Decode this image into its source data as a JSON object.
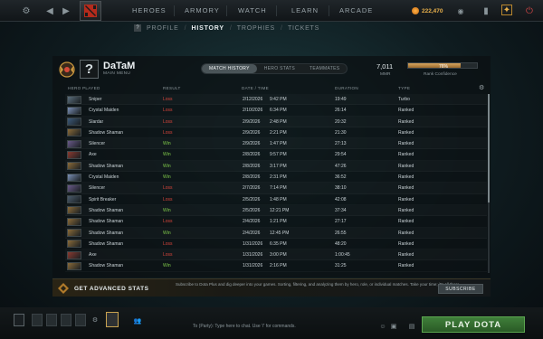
{
  "topbar": {
    "nav": [
      "HEROES",
      "ARMORY",
      "WATCH",
      "LEARN",
      "ARCADE"
    ],
    "currency_value": "222,470"
  },
  "subnav": {
    "help": "?",
    "items": [
      "PROFILE",
      "HISTORY",
      "TROPHIES",
      "TICKETS"
    ],
    "active": "HISTORY"
  },
  "profile": {
    "avatar_glyph": "?",
    "name": "DaTaM",
    "subtitle": "MAIN MENU",
    "tabs": [
      "MATCH HISTORY",
      "HERO STATS",
      "TEAMMATES"
    ],
    "mmr_value": "7,011",
    "mmr_label": "MMR",
    "confidence_percent": 76,
    "confidence_text": "76%",
    "confidence_label": "Rank Confidence"
  },
  "table": {
    "headers": [
      "HERO PLAYED",
      "RESULT",
      "DATE / TIME",
      "DURATION",
      "TYPE"
    ],
    "rows": [
      {
        "hero": "Sniper",
        "result": "Loss",
        "date": "2/12/2026",
        "time": "9:42 PM",
        "duration": "19:49",
        "type": "Turbo",
        "color": "#5b6e7d"
      },
      {
        "hero": "Crystal Maiden",
        "result": "Loss",
        "date": "2/10/2026",
        "time": "6:34 PM",
        "duration": "26:14",
        "type": "Ranked",
        "color": "#7a8fb5"
      },
      {
        "hero": "Slardar",
        "result": "Loss",
        "date": "2/9/2026",
        "time": "2:48 PM",
        "duration": "20:32",
        "type": "Ranked",
        "color": "#3d5a7a"
      },
      {
        "hero": "Shadow Shaman",
        "result": "Loss",
        "date": "2/9/2026",
        "time": "2:21 PM",
        "duration": "21:30",
        "type": "Ranked",
        "color": "#8a6b3a"
      },
      {
        "hero": "Silencer",
        "result": "Win",
        "date": "2/9/2026",
        "time": "1:47 PM",
        "duration": "27:13",
        "type": "Ranked",
        "color": "#6a5a8a"
      },
      {
        "hero": "Axe",
        "result": "Win",
        "date": "2/8/2026",
        "time": "9:57 PM",
        "duration": "29:54",
        "type": "Ranked",
        "color": "#8a3a30"
      },
      {
        "hero": "Shadow Shaman",
        "result": "Win",
        "date": "2/8/2026",
        "time": "3:17 PM",
        "duration": "47:26",
        "type": "Ranked",
        "color": "#8a6b3a"
      },
      {
        "hero": "Crystal Maiden",
        "result": "Win",
        "date": "2/8/2026",
        "time": "2:31 PM",
        "duration": "36:52",
        "type": "Ranked",
        "color": "#7a8fb5"
      },
      {
        "hero": "Silencer",
        "result": "Loss",
        "date": "2/7/2026",
        "time": "7:14 PM",
        "duration": "38:10",
        "type": "Ranked",
        "color": "#6a5a8a"
      },
      {
        "hero": "Spirit Breaker",
        "result": "Loss",
        "date": "2/5/2026",
        "time": "1:48 PM",
        "duration": "42:08",
        "type": "Ranked",
        "color": "#4a5a6a"
      },
      {
        "hero": "Shadow Shaman",
        "result": "Win",
        "date": "2/5/2026",
        "time": "12:21 PM",
        "duration": "37:34",
        "type": "Ranked",
        "color": "#8a6b3a"
      },
      {
        "hero": "Shadow Shaman",
        "result": "Loss",
        "date": "2/4/2026",
        "time": "1:21 PM",
        "duration": "27:17",
        "type": "Ranked",
        "color": "#8a6b3a"
      },
      {
        "hero": "Shadow Shaman",
        "result": "Win",
        "date": "2/4/2026",
        "time": "12:45 PM",
        "duration": "26:55",
        "type": "Ranked",
        "color": "#8a6b3a"
      },
      {
        "hero": "Shadow Shaman",
        "result": "Loss",
        "date": "1/31/2026",
        "time": "6:35 PM",
        "duration": "48:20",
        "type": "Ranked",
        "color": "#8a6b3a"
      },
      {
        "hero": "Axe",
        "result": "Loss",
        "date": "1/31/2026",
        "time": "3:00 PM",
        "duration": "1:00:45",
        "type": "Ranked",
        "color": "#8a3a30"
      },
      {
        "hero": "Shadow Shaman",
        "result": "Win",
        "date": "1/31/2026",
        "time": "2:16 PM",
        "duration": "31:25",
        "type": "Ranked",
        "color": "#8a6b3a"
      }
    ]
  },
  "advanced": {
    "title": "GET ADVANCED STATS",
    "description": "Subscribe to Dota Plus and dig deeper into your games. Sorting, filtering, and analyzing them by hero, role, or individual matches. Take your time; it's all there.",
    "button": "SUBSCRIBE"
  },
  "bottom": {
    "chat_placeholder": "To (Party): Type here to chat. Use '/' for commands.",
    "play_button": "PLAY DOTA"
  },
  "colors": {
    "win": "#7fc94a",
    "loss": "#d5453b",
    "play": "#3f7f3a",
    "gold": "#e8b04b"
  }
}
